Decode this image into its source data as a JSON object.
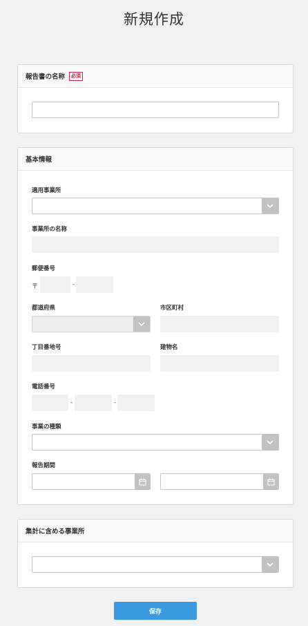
{
  "page": {
    "title": "新規作成"
  },
  "report_name": {
    "header": "報告書の名称",
    "required_badge": "必須",
    "value": ""
  },
  "basic_info": {
    "header": "基本情報",
    "office": {
      "label": "適用事業所",
      "value": ""
    },
    "office_name": {
      "label": "事業所の名称",
      "value": ""
    },
    "postal": {
      "label": "郵便番号",
      "prefix": "〒",
      "separator": "-",
      "part1": "",
      "part2": ""
    },
    "prefecture": {
      "label": "都道府県",
      "value": ""
    },
    "city": {
      "label": "市区町村",
      "value": ""
    },
    "address": {
      "label": "丁目番地号",
      "value": ""
    },
    "building": {
      "label": "建物名",
      "value": ""
    },
    "phone": {
      "label": "電話番号",
      "separator": "-",
      "part1": "",
      "part2": "",
      "part3": ""
    },
    "business_type": {
      "label": "事業の種類",
      "value": ""
    },
    "period": {
      "label": "報告期間",
      "start": "",
      "end": ""
    }
  },
  "aggregate": {
    "header": "集計に含める事業所",
    "value": ""
  },
  "actions": {
    "save_label": "保存"
  },
  "colors": {
    "accent": "#3a9ae0",
    "required": "#cc2244",
    "background": "#f1f1f1"
  }
}
